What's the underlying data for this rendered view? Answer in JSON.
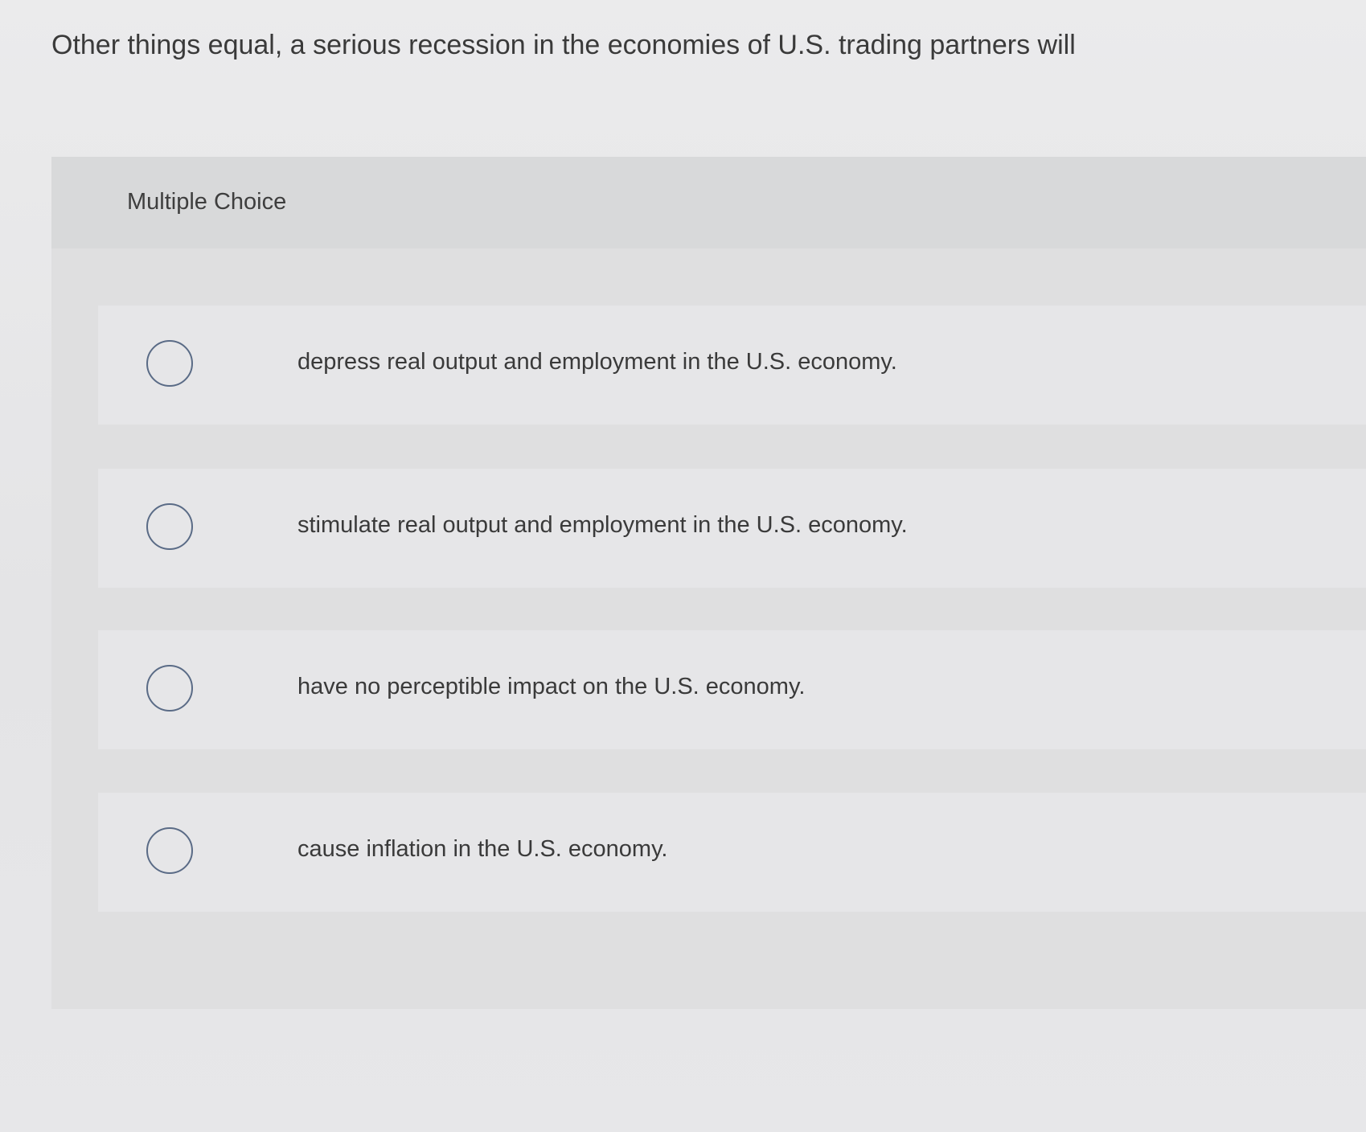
{
  "question": {
    "text": "Other things equal, a serious recession in the economies of U.S. trading partners will"
  },
  "multiple_choice": {
    "label": "Multiple Choice",
    "options": [
      {
        "label": "depress real output and employment in the U.S. economy.",
        "selected": false
      },
      {
        "label": "stimulate real output and employment in the U.S. economy.",
        "selected": false
      },
      {
        "label": "have no perceptible impact on the U.S. economy.",
        "selected": false
      },
      {
        "label": "cause inflation in the U.S. economy.",
        "selected": false
      }
    ]
  },
  "colors": {
    "page_background": "#e8e8e9",
    "panel_background": "#dfdfe0",
    "option_background": "#e6e6e8",
    "radio_border": "#5a6b86",
    "text": "#3a3a3a"
  }
}
